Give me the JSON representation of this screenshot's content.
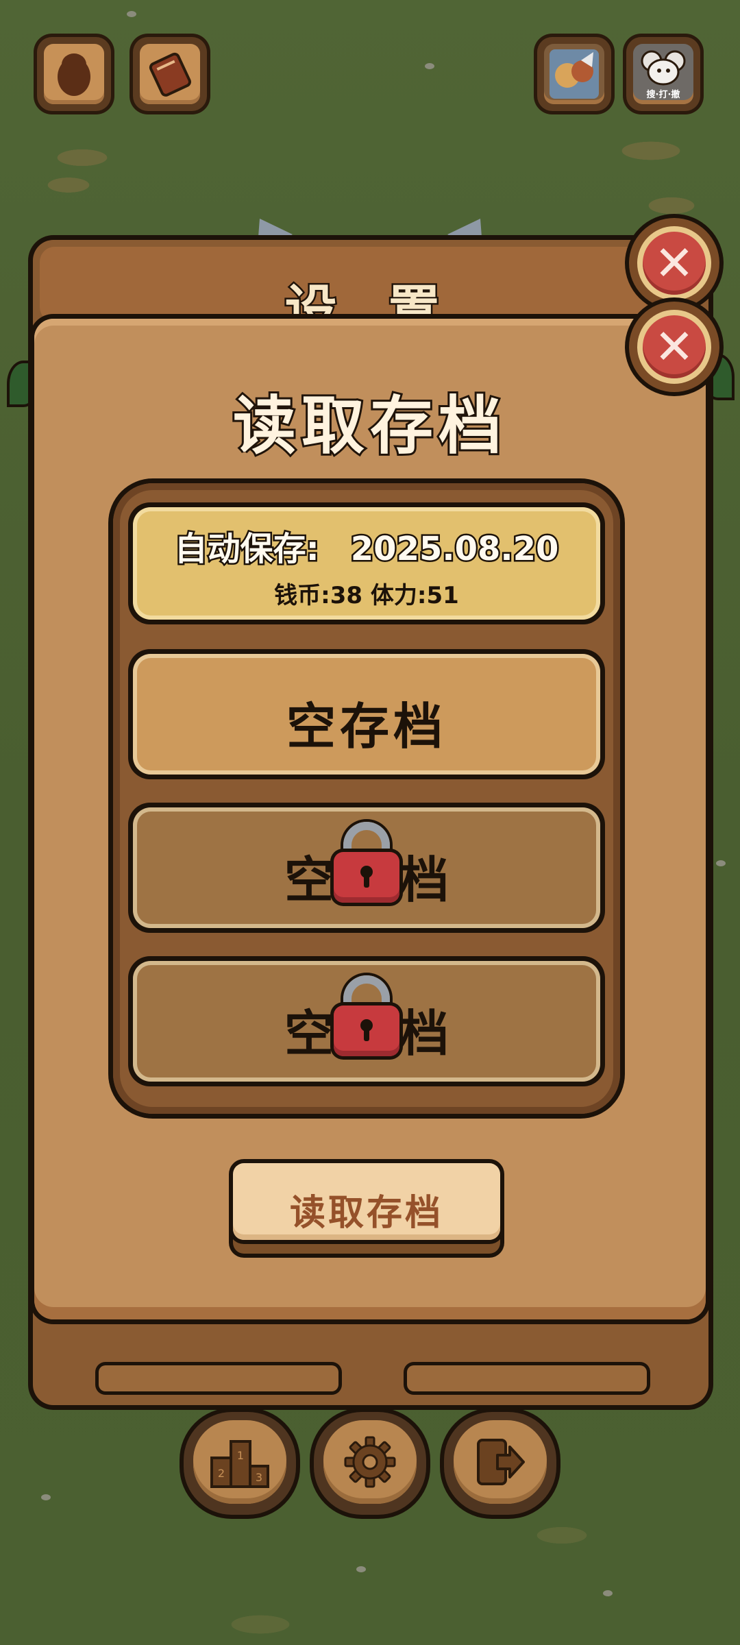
{
  "top_bar": {
    "left_buttons": [
      {
        "icon": "penguin-icon"
      },
      {
        "icon": "book-icon"
      }
    ],
    "right_buttons": [
      {
        "icon": "heroes-portrait-icon"
      },
      {
        "icon": "mouse-portrait-icon",
        "caption": "搜·打·撤"
      }
    ]
  },
  "background_panel": {
    "title": "设 置"
  },
  "dialog": {
    "title": "读取存档",
    "slots": [
      {
        "type": "auto",
        "line1_label": "自动保存:",
        "line1_value": "2025.08.20",
        "line2": "钱币:38 体力:51"
      },
      {
        "type": "empty",
        "label": "空存档"
      },
      {
        "type": "locked",
        "label_left": "空",
        "label_right": "档"
      },
      {
        "type": "locked",
        "label_left": "空",
        "label_right": "档"
      }
    ],
    "load_button": "读取存档",
    "close_icon": "close-icon"
  },
  "bottom_bar": {
    "buttons": [
      {
        "icon": "podium-icon",
        "ranks": [
          "1",
          "2",
          "3"
        ]
      },
      {
        "icon": "gear-icon"
      },
      {
        "icon": "exit-icon"
      }
    ]
  },
  "colors": {
    "grass": "#4d6132",
    "board": "#c18f5c",
    "outline": "#1c1209",
    "auto_slot": "#e2c06e",
    "close_red": "#c94a42"
  }
}
